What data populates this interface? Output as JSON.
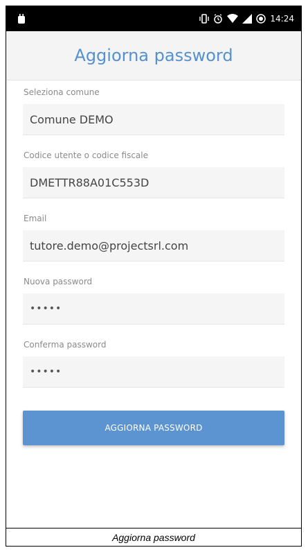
{
  "status_bar": {
    "time": "14:24",
    "icons": [
      "vibrate-icon",
      "alarm-icon",
      "wifi-icon",
      "signal-icon",
      "sync-icon"
    ]
  },
  "app_bar": {
    "title": "Aggiorna password"
  },
  "form": {
    "comune": {
      "label": "Seleziona comune",
      "value": "Comune DEMO"
    },
    "codice": {
      "label": "Codice utente o codice fiscale",
      "value": "DMETTR88A01C553D"
    },
    "email": {
      "label": "Email",
      "value": "tutore.demo@projectsrl.com"
    },
    "nuova_password": {
      "label": "Nuova password",
      "value": "•••••"
    },
    "conferma_password": {
      "label": "Conferma password",
      "value": "•••••"
    },
    "submit_label": "AGGIORNA PASSWORD"
  },
  "caption": "Aggiorna password",
  "colors": {
    "accent": "#5590cf",
    "button": "#5b94d0",
    "field_bg": "#f5f5f5"
  }
}
